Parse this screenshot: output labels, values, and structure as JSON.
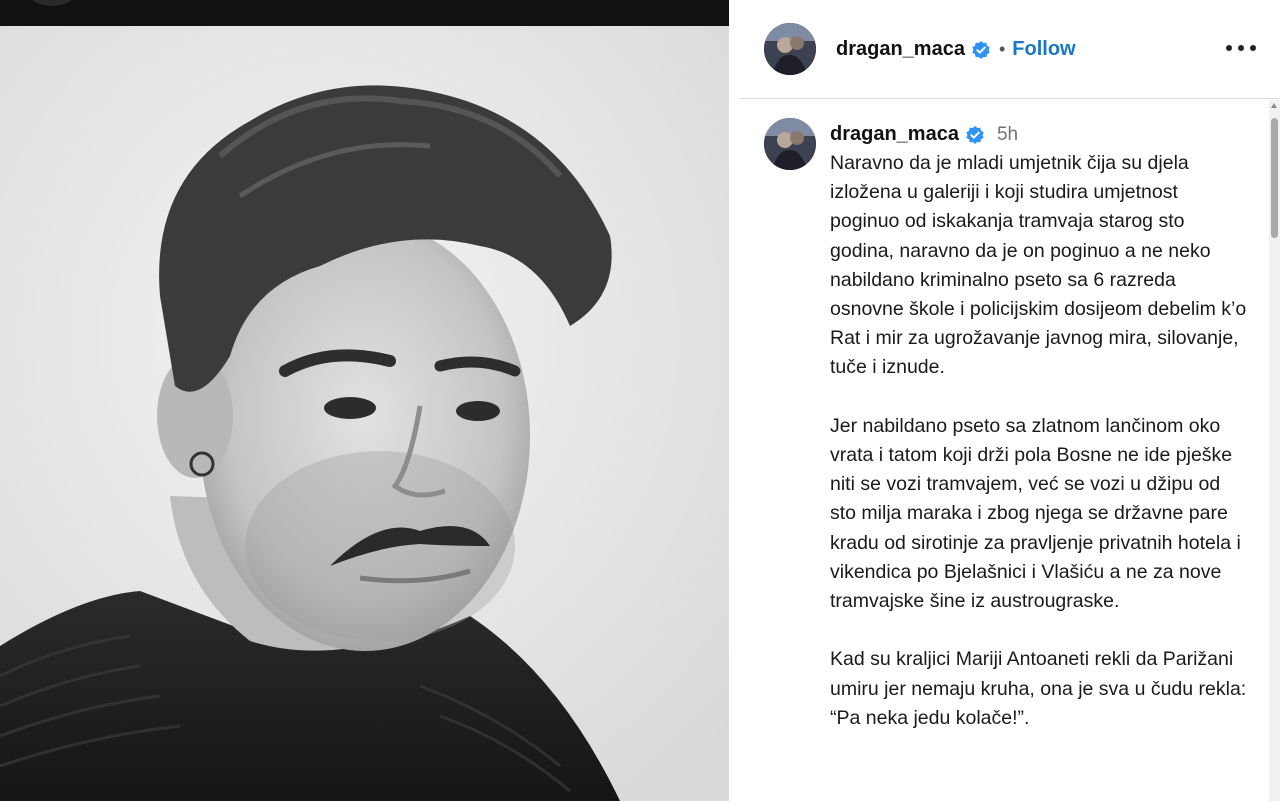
{
  "post": {
    "username": "dragan_maca",
    "follow_label": "Follow",
    "separator": "•",
    "more_icon": "more-options-icon",
    "verified_icon": "verified-badge-icon"
  },
  "caption": {
    "username": "dragan_maca",
    "time": "5h",
    "paragraphs": [
      "Naravno da je mladi umjetnik čija su djela izložena u galeriji i koji studira umjetnost poginuo od iskakanja tramvaja starog sto godina, naravno da je on poginuo a ne neko nabildano kriminalno pseto sa 6 razreda osnovne škole i policijskim dosijeom debelim k’o Rat i mir za ugrožavanje javnog mira, silovanje, tuče i iznude.",
      "Jer nabildano pseto sa zlatnom lančinom oko vrata i tatom koji drži pola Bosne ne ide pješke niti se vozi tramvajem, već se vozi u džipu od sto milja maraka i zbog njega se državne pare kradu od sirotinje za pravljenje privatnih hotela i vikendica po Bjelašnici i Vlašiću a ne za nove tramvajske šine iz austrougraske.",
      "Kad su kraljici Mariji Antoaneti rekli da Parižani umiru jer nemaju kruha, ona je sva u čudu rekla: “Pa neka jedu kolače!”."
    ]
  },
  "colors": {
    "follow": "#1877c9",
    "verified": "#2f93f5",
    "muted": "#737373"
  }
}
